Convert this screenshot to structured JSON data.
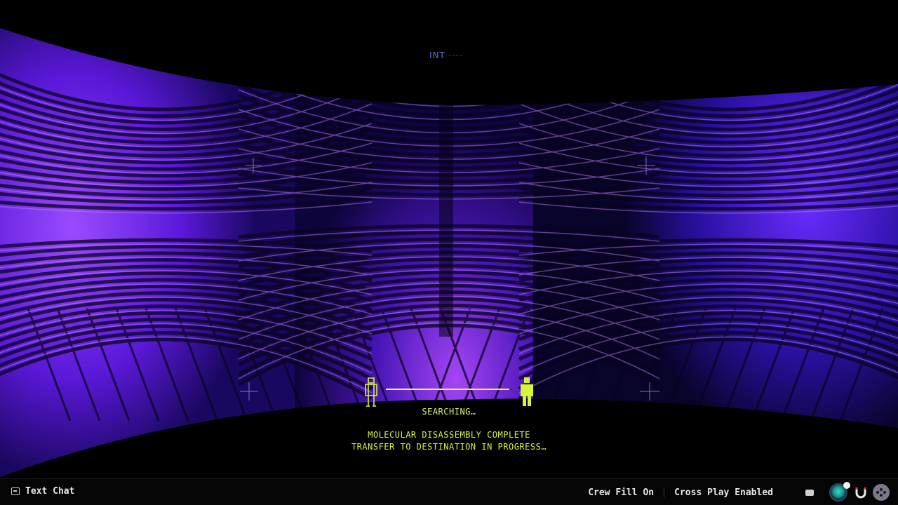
{
  "hud": {
    "top_label": "INT",
    "top_label_faded": "----",
    "status": "SEARCHING…",
    "message_line1": "MOLECULAR DISASSEMBLY COMPLETE",
    "message_line2": "TRANSFER TO DESTINATION IN PROGRESS…",
    "transfer_progress": 0.98,
    "accent_color": "#d6f43a",
    "background_color": "#6a1fe0"
  },
  "bottom_bar": {
    "text_chat_label": "Text Chat",
    "crew_fill_label": "Crew Fill On",
    "cross_play_label": "Cross Play Enabled",
    "icons": [
      "chat-bubble-icon",
      "player-avatar",
      "mic-icon",
      "magnet-icon",
      "party-icon"
    ]
  }
}
